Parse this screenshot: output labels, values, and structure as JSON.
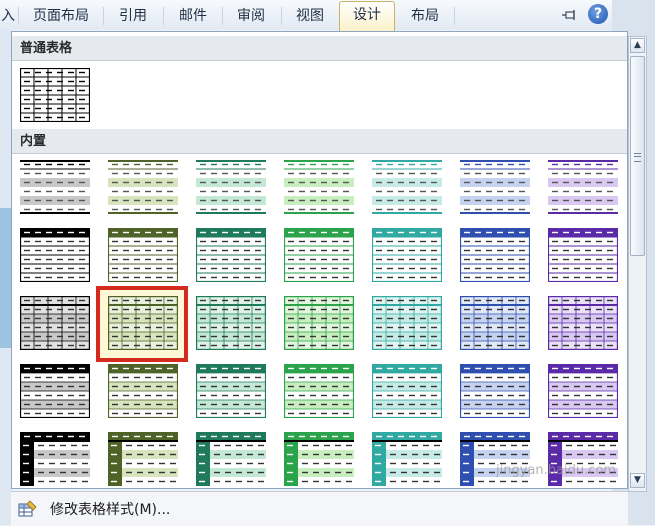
{
  "ribbon": {
    "tabs": [
      {
        "label": "页面布局",
        "active": false
      },
      {
        "label": "引用",
        "active": false
      },
      {
        "label": "邮件",
        "active": false
      },
      {
        "label": "审阅",
        "active": false
      },
      {
        "label": "视图",
        "active": false
      },
      {
        "label": "设计",
        "active": true
      },
      {
        "label": "布局",
        "active": false
      }
    ],
    "left_partial": "入",
    "help_label": "?"
  },
  "gallery": {
    "sections": [
      {
        "title": "普通表格"
      },
      {
        "title": "内置"
      }
    ],
    "plain_style": {
      "name": "plain-grid",
      "color": "#000000"
    },
    "columns": [
      {
        "name": "black",
        "color": "#000000",
        "light": "#c8c8c8"
      },
      {
        "name": "olive-green",
        "color": "#4f6228",
        "light": "#d7e4bd"
      },
      {
        "name": "teal-green",
        "color": "#1f7a5b",
        "light": "#c4e8d6"
      },
      {
        "name": "green",
        "color": "#2aa34a",
        "light": "#c8eec0"
      },
      {
        "name": "aqua",
        "color": "#31a9a3",
        "light": "#c6ebe6"
      },
      {
        "name": "blue",
        "color": "#2f4fb0",
        "light": "#c6d3f0"
      },
      {
        "name": "purple",
        "color": "#5a2aa8",
        "light": "#d8c8f2"
      }
    ],
    "rows": [
      "light-shading",
      "header-row",
      "grid",
      "medium-shading",
      "first-column"
    ],
    "selected": {
      "row": 2,
      "column": 1
    }
  },
  "bottom_menu": {
    "modify_label": "修改表格样式(M)..."
  },
  "watermark": "jingyan.baidu.com"
}
